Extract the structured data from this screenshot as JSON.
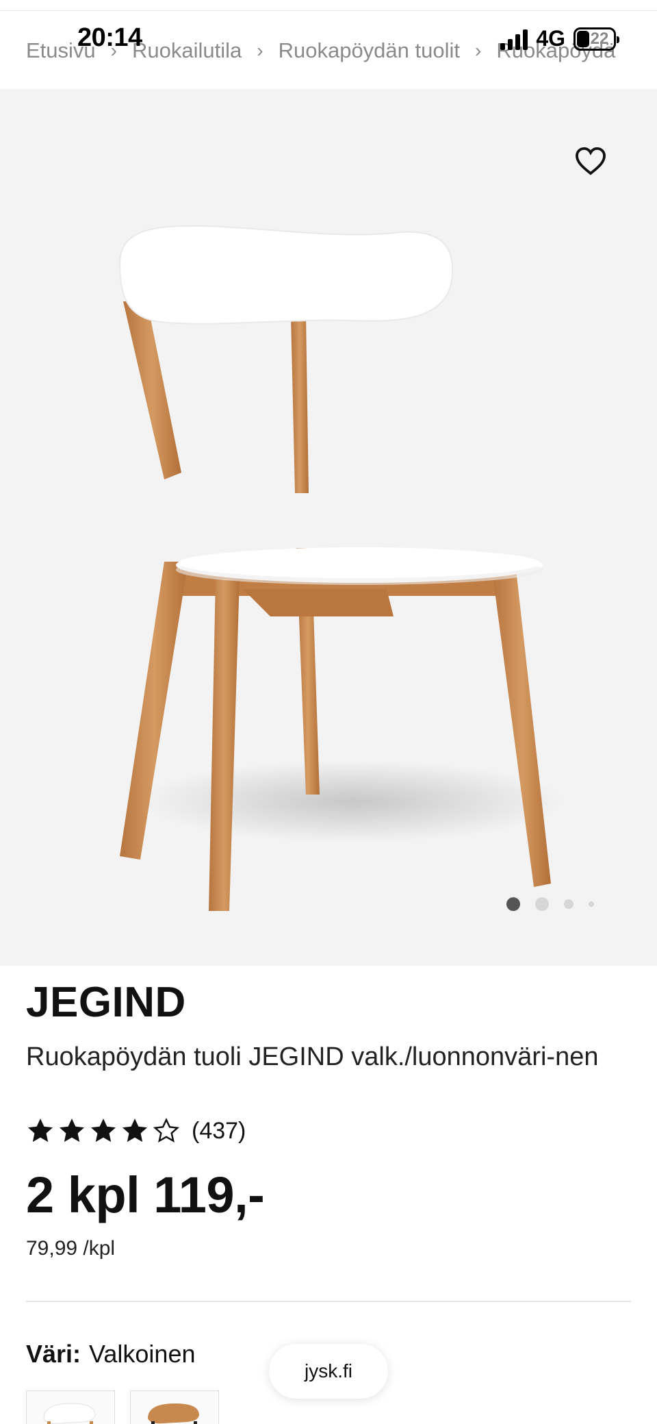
{
  "status_bar": {
    "time": "20:14",
    "network": "4G",
    "battery": "22"
  },
  "breadcrumb": {
    "items": [
      "Etusivu",
      "Ruokailutila",
      "Ruokapöydän tuolit",
      "Ruokapöydä"
    ]
  },
  "gallery": {
    "image_count": 4,
    "active_index": 0,
    "favorite_icon": "heart-outline-icon"
  },
  "product": {
    "brand": "JEGIND",
    "name": "Ruokapöydän tuoli JEGIND valk./luonnonväri-nen",
    "rating_value": 4,
    "rating_max": 5,
    "review_count": "(437)",
    "price": "2 kpl 119,-",
    "unit_price": "79,99 /kpl"
  },
  "color": {
    "label": "Väri:",
    "value": "Valkoinen",
    "options": [
      "white-oak",
      "oak-black"
    ]
  },
  "browser": {
    "url": "jysk.fi"
  },
  "colors": {
    "accent": "#111111",
    "wood": "#c8894f",
    "gallery_bg": "#f4f3f3"
  }
}
